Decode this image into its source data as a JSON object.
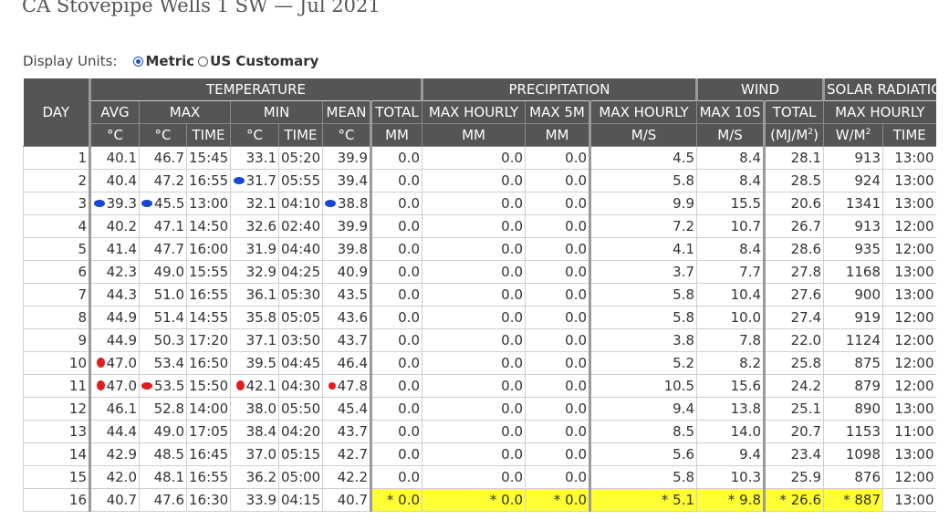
{
  "title": "CA Stovepipe Wells 1 SW — Jul 2021",
  "units": {
    "label": "Display Units:",
    "options": [
      {
        "label": "Metric",
        "selected": true
      },
      {
        "label": "US Customary",
        "selected": false
      }
    ]
  },
  "headers": {
    "day": "DAY",
    "groups": [
      "TEMPERATURE",
      "PRECIPITATION",
      "WIND",
      "SOLAR RADIATION"
    ],
    "sub": {
      "avg": "AVG",
      "max": "MAX",
      "min": "MIN",
      "mean": "MEAN",
      "total": "TOTAL",
      "max_hourly": "MAX HOURLY",
      "max_5m": "MAX 5M",
      "wind_max_hourly": "MAX HOURLY",
      "max_10s": "MAX 10S",
      "solar_total": "TOTAL",
      "solar_max_hourly": "MAX HOURLY"
    },
    "units": {
      "c": "°C",
      "time": "TIME",
      "mm": "MM",
      "ms": "M/S",
      "mjm2": "(MJ/M",
      "wm2": "W/M",
      "sq": "2",
      "close": ")"
    }
  },
  "colors": {
    "record_high": "#e21d1d",
    "record_low": "#1546d8",
    "estimated": "#ffff33"
  },
  "markers": [
    {
      "day": 2,
      "field": "min",
      "color": "blue"
    },
    {
      "day": 3,
      "field": "avg",
      "color": "blue"
    },
    {
      "day": 3,
      "field": "max",
      "color": "blue"
    },
    {
      "day": 3,
      "field": "mean",
      "color": "blue"
    },
    {
      "day": 10,
      "field": "avg",
      "color": "red"
    },
    {
      "day": 11,
      "field": "avg",
      "color": "red"
    },
    {
      "day": 11,
      "field": "max",
      "color": "red"
    },
    {
      "day": 11,
      "field": "min",
      "color": "red"
    },
    {
      "day": 11,
      "field": "mean",
      "color": "red"
    }
  ],
  "rows": [
    {
      "day": "1",
      "avg": "40.1",
      "max": "46.7",
      "max_t": "15:45",
      "min": "33.1",
      "min_t": "05:20",
      "mean": "39.9",
      "p_tot": "0.0",
      "p_hr": "0.0",
      "p_5m": "0.0",
      "w_hr": "4.5",
      "w_10s": "8.4",
      "s_tot": "28.1",
      "s_hr": "913",
      "s_t": "13:00"
    },
    {
      "day": "2",
      "avg": "40.4",
      "max": "47.2",
      "max_t": "16:55",
      "min": "31.7",
      "min_t": "05:55",
      "mean": "39.4",
      "p_tot": "0.0",
      "p_hr": "0.0",
      "p_5m": "0.0",
      "w_hr": "5.8",
      "w_10s": "8.4",
      "s_tot": "28.5",
      "s_hr": "924",
      "s_t": "13:00"
    },
    {
      "day": "3",
      "avg": "39.3",
      "max": "45.5",
      "max_t": "13:00",
      "min": "32.1",
      "min_t": "04:10",
      "mean": "38.8",
      "p_tot": "0.0",
      "p_hr": "0.0",
      "p_5m": "0.0",
      "w_hr": "9.9",
      "w_10s": "15.5",
      "s_tot": "20.6",
      "s_hr": "1341",
      "s_t": "13:00"
    },
    {
      "day": "4",
      "avg": "40.2",
      "max": "47.1",
      "max_t": "14:50",
      "min": "32.6",
      "min_t": "02:40",
      "mean": "39.9",
      "p_tot": "0.0",
      "p_hr": "0.0",
      "p_5m": "0.0",
      "w_hr": "7.2",
      "w_10s": "10.7",
      "s_tot": "26.7",
      "s_hr": "913",
      "s_t": "12:00"
    },
    {
      "day": "5",
      "avg": "41.4",
      "max": "47.7",
      "max_t": "16:00",
      "min": "31.9",
      "min_t": "04:40",
      "mean": "39.8",
      "p_tot": "0.0",
      "p_hr": "0.0",
      "p_5m": "0.0",
      "w_hr": "4.1",
      "w_10s": "8.4",
      "s_tot": "28.6",
      "s_hr": "935",
      "s_t": "12:00"
    },
    {
      "day": "6",
      "avg": "42.3",
      "max": "49.0",
      "max_t": "15:55",
      "min": "32.9",
      "min_t": "04:25",
      "mean": "40.9",
      "p_tot": "0.0",
      "p_hr": "0.0",
      "p_5m": "0.0",
      "w_hr": "3.7",
      "w_10s": "7.7",
      "s_tot": "27.8",
      "s_hr": "1168",
      "s_t": "13:00"
    },
    {
      "day": "7",
      "avg": "44.3",
      "max": "51.0",
      "max_t": "16:55",
      "min": "36.1",
      "min_t": "05:30",
      "mean": "43.5",
      "p_tot": "0.0",
      "p_hr": "0.0",
      "p_5m": "0.0",
      "w_hr": "5.8",
      "w_10s": "10.4",
      "s_tot": "27.6",
      "s_hr": "900",
      "s_t": "13:00"
    },
    {
      "day": "8",
      "avg": "44.9",
      "max": "51.4",
      "max_t": "14:55",
      "min": "35.8",
      "min_t": "05:05",
      "mean": "43.6",
      "p_tot": "0.0",
      "p_hr": "0.0",
      "p_5m": "0.0",
      "w_hr": "5.8",
      "w_10s": "10.0",
      "s_tot": "27.4",
      "s_hr": "919",
      "s_t": "12:00"
    },
    {
      "day": "9",
      "avg": "44.9",
      "max": "50.3",
      "max_t": "17:20",
      "min": "37.1",
      "min_t": "03:50",
      "mean": "43.7",
      "p_tot": "0.0",
      "p_hr": "0.0",
      "p_5m": "0.0",
      "w_hr": "3.8",
      "w_10s": "7.8",
      "s_tot": "22.0",
      "s_hr": "1124",
      "s_t": "12:00"
    },
    {
      "day": "10",
      "avg": "47.0",
      "max": "53.4",
      "max_t": "16:50",
      "min": "39.5",
      "min_t": "04:45",
      "mean": "46.4",
      "p_tot": "0.0",
      "p_hr": "0.0",
      "p_5m": "0.0",
      "w_hr": "5.2",
      "w_10s": "8.2",
      "s_tot": "25.8",
      "s_hr": "875",
      "s_t": "12:00"
    },
    {
      "day": "11",
      "avg": "47.0",
      "max": "53.5",
      "max_t": "15:50",
      "min": "42.1",
      "min_t": "04:30",
      "mean": "47.8",
      "p_tot": "0.0",
      "p_hr": "0.0",
      "p_5m": "0.0",
      "w_hr": "10.5",
      "w_10s": "15.6",
      "s_tot": "24.2",
      "s_hr": "879",
      "s_t": "12:00"
    },
    {
      "day": "12",
      "avg": "46.1",
      "max": "52.8",
      "max_t": "14:00",
      "min": "38.0",
      "min_t": "05:50",
      "mean": "45.4",
      "p_tot": "0.0",
      "p_hr": "0.0",
      "p_5m": "0.0",
      "w_hr": "9.4",
      "w_10s": "13.8",
      "s_tot": "25.1",
      "s_hr": "890",
      "s_t": "13:00"
    },
    {
      "day": "13",
      "avg": "44.4",
      "max": "49.0",
      "max_t": "17:05",
      "min": "38.4",
      "min_t": "04:20",
      "mean": "43.7",
      "p_tot": "0.0",
      "p_hr": "0.0",
      "p_5m": "0.0",
      "w_hr": "8.5",
      "w_10s": "14.0",
      "s_tot": "20.7",
      "s_hr": "1153",
      "s_t": "11:00"
    },
    {
      "day": "14",
      "avg": "42.9",
      "max": "48.5",
      "max_t": "16:45",
      "min": "37.0",
      "min_t": "05:15",
      "mean": "42.7",
      "p_tot": "0.0",
      "p_hr": "0.0",
      "p_5m": "0.0",
      "w_hr": "5.6",
      "w_10s": "9.4",
      "s_tot": "23.4",
      "s_hr": "1098",
      "s_t": "13:00"
    },
    {
      "day": "15",
      "avg": "42.0",
      "max": "48.1",
      "max_t": "16:55",
      "min": "36.2",
      "min_t": "05:00",
      "mean": "42.2",
      "p_tot": "0.0",
      "p_hr": "0.0",
      "p_5m": "0.0",
      "w_hr": "5.8",
      "w_10s": "10.3",
      "s_tot": "25.9",
      "s_hr": "876",
      "s_t": "12:00"
    },
    {
      "day": "16",
      "avg": "40.7",
      "max": "47.6",
      "max_t": "16:30",
      "min": "33.9",
      "min_t": "04:15",
      "mean": "40.7",
      "p_tot": "* 0.0",
      "p_hr": "* 0.0",
      "p_5m": "* 0.0",
      "w_hr": "* 5.1",
      "w_10s": "* 9.8",
      "s_tot": "* 26.6",
      "s_hr": "* 887",
      "s_t": "13:00",
      "estimated": [
        "p_tot",
        "p_hr",
        "p_5m",
        "w_hr",
        "w_10s",
        "s_tot",
        "s_hr"
      ]
    }
  ]
}
